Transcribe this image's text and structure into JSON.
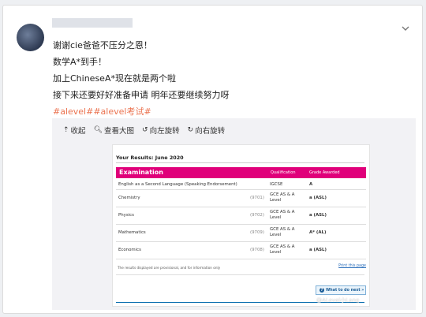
{
  "post": {
    "lines": [
      "谢谢cie爸爸不压分之恩！",
      "数学A*到手！",
      "加上ChineseA*现在就是两个啦",
      "接下来还要好好准备申请 明年还要继续努力呀"
    ],
    "tags": "#alevel##alevel考试#"
  },
  "media_toolbar": {
    "collapse": "收起",
    "view_large": "查看大图",
    "rotate_left": "向左旋转",
    "rotate_right": "向右旋转"
  },
  "results": {
    "title": "Your Results: June 2020",
    "header": {
      "exam": "Examination",
      "qualification": "Qualification",
      "grade": "Grade Awarded"
    },
    "rows": [
      {
        "subject": "English as a Second Language (Speaking Endorsement)",
        "code": "(0510)",
        "qualification": "IGCSE",
        "grade": "A"
      },
      {
        "subject": "Chemistry",
        "code": "(9701)",
        "qualification": "GCE AS & A Level",
        "grade": "a (ASL)"
      },
      {
        "subject": "Physics",
        "code": "(9702)",
        "qualification": "GCE AS & A Level",
        "grade": "a (ASL)"
      },
      {
        "subject": "Mathematics",
        "code": "(9709)",
        "qualification": "GCE AS & A Level",
        "grade": "A* (AL)"
      },
      {
        "subject": "Economics",
        "code": "(9708)",
        "qualification": "GCE AS & A Level",
        "grade": "a (ASL)"
      }
    ],
    "note": "The results displayed are provisional, and for information only",
    "print": "Print this page",
    "next": "What to do next »"
  },
  "watermark": "@ALevel小Lang",
  "icons": {
    "chevron": "chevron-down-icon",
    "collapse": "collapse-icon",
    "search": "search-icon",
    "rotate_left": "rotate-left-icon",
    "rotate_right": "rotate-right-icon"
  },
  "colors": {
    "tag": "#eb7350",
    "header": "#e0007a",
    "link": "#2a6ebb"
  }
}
